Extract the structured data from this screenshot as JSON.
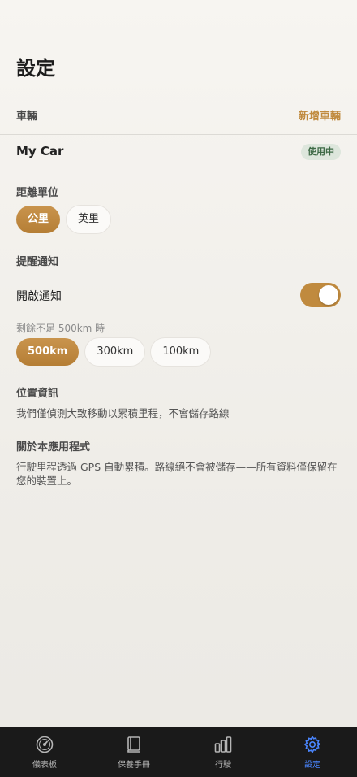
{
  "header": {
    "title": "設定"
  },
  "vehicles": {
    "label": "車輛",
    "add_label": "新增車輛",
    "items": [
      {
        "name": "My Car",
        "badge": "使用中"
      }
    ]
  },
  "distance_unit": {
    "label": "距離單位",
    "options": [
      {
        "label": "公里",
        "selected": true
      },
      {
        "label": "英里",
        "selected": false
      }
    ]
  },
  "reminder": {
    "label": "提醒通知",
    "toggle_label": "開啟通知",
    "enabled": true,
    "threshold_hint": "剩餘不足 500km 時",
    "thresholds": [
      {
        "label": "500km",
        "selected": true
      },
      {
        "label": "300km",
        "selected": false
      },
      {
        "label": "100km",
        "selected": false
      }
    ]
  },
  "location": {
    "label": "位置資訊",
    "text": "我們僅偵測大致移動以累積里程，不會儲存路線"
  },
  "about": {
    "label": "關於本應用程式",
    "text": "行駛里程透過 GPS 自動累積。路線絕不會被儲存——所有資料僅保留在您的裝置上。"
  },
  "tabbar": {
    "items": [
      {
        "label": "儀表板",
        "icon": "gauge-icon",
        "active": false
      },
      {
        "label": "保養手冊",
        "icon": "book-icon",
        "active": false
      },
      {
        "label": "行駛",
        "icon": "bar-chart-icon",
        "active": false
      },
      {
        "label": "設定",
        "icon": "gear-icon",
        "active": true
      }
    ]
  },
  "colors": {
    "accent": "#c08a3e",
    "tab_active": "#4a86ff",
    "badge_bg": "#dde6dc",
    "badge_text": "#3e6a46"
  }
}
